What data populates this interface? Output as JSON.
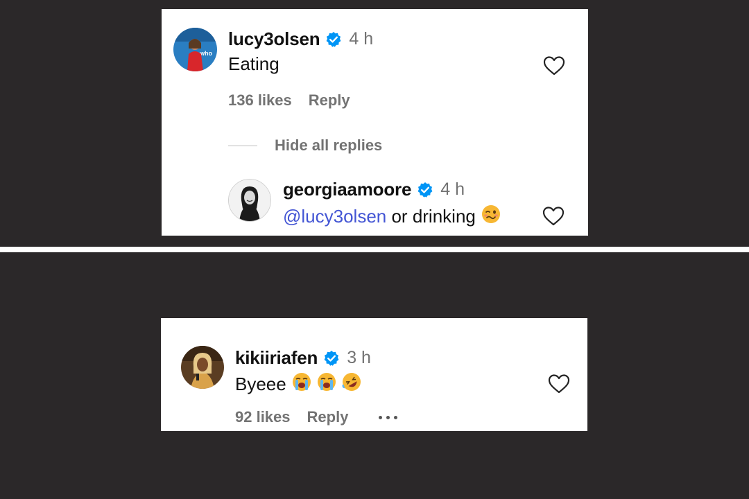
{
  "top_card": {
    "comment": {
      "username": "lucy3olsen",
      "time": "4 h",
      "text": "Eating",
      "likes": "136 likes",
      "reply_label": "Reply"
    },
    "hide_replies_label": "Hide all replies",
    "reply": {
      "username": "georgiaamoore",
      "time": "4 h",
      "mention": "@lucy3olsen",
      "text": " or drinking"
    }
  },
  "bottom_card": {
    "comment": {
      "username": "kikiiriafen",
      "time": "3 h",
      "text": "Byeee",
      "likes": "92 likes",
      "reply_label": "Reply"
    }
  },
  "colors": {
    "background": "#2b2829",
    "verified": "#0095f6",
    "mention": "#4355d4",
    "muted": "#737373"
  },
  "icons": {
    "verified": "verified-badge-icon",
    "like": "heart-outline-icon",
    "more": "more-horizontal-icon",
    "emoji_reply": "woozy-face-emoji",
    "emoji_cry": "loudly-crying-face-emoji",
    "emoji_laugh": "rolling-on-floor-laughing-emoji"
  }
}
